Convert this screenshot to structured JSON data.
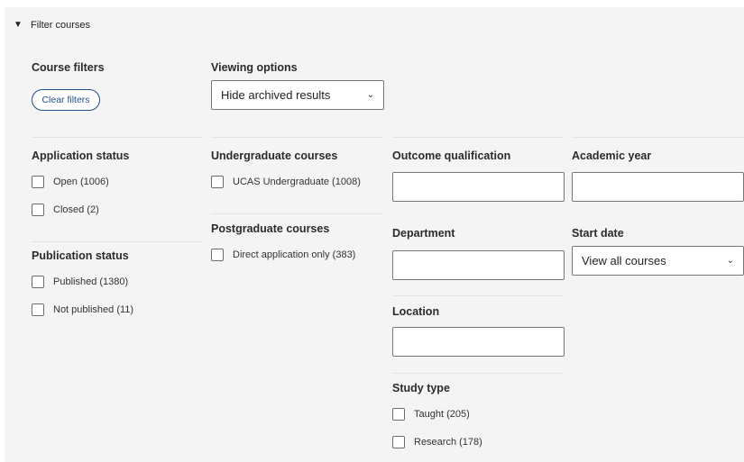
{
  "header": {
    "toggle_icon": "triangle-down",
    "title": "Filter courses"
  },
  "course_filters": {
    "heading": "Course filters",
    "clear_label": "Clear filters"
  },
  "viewing_options": {
    "heading": "Viewing options",
    "selected": "Hide archived results"
  },
  "application_status": {
    "heading": "Application status",
    "options": [
      "Open (1006)",
      "Closed (2)"
    ]
  },
  "publication_status": {
    "heading": "Publication status",
    "options": [
      "Published (1380)",
      "Not published (11)"
    ]
  },
  "undergraduate": {
    "heading": "Undergraduate courses",
    "options": [
      "UCAS Undergraduate (1008)"
    ]
  },
  "postgraduate": {
    "heading": "Postgraduate courses",
    "options": [
      "Direct application only (383)"
    ]
  },
  "outcome_qualification": {
    "heading": "Outcome qualification",
    "value": ""
  },
  "academic_year": {
    "heading": "Academic year",
    "value": ""
  },
  "department": {
    "heading": "Department",
    "value": ""
  },
  "start_date": {
    "heading": "Start date",
    "selected": "View all courses"
  },
  "location": {
    "heading": "Location",
    "value": ""
  },
  "study_type": {
    "heading": "Study type",
    "options": [
      "Taught (205)",
      "Research (178)"
    ]
  }
}
